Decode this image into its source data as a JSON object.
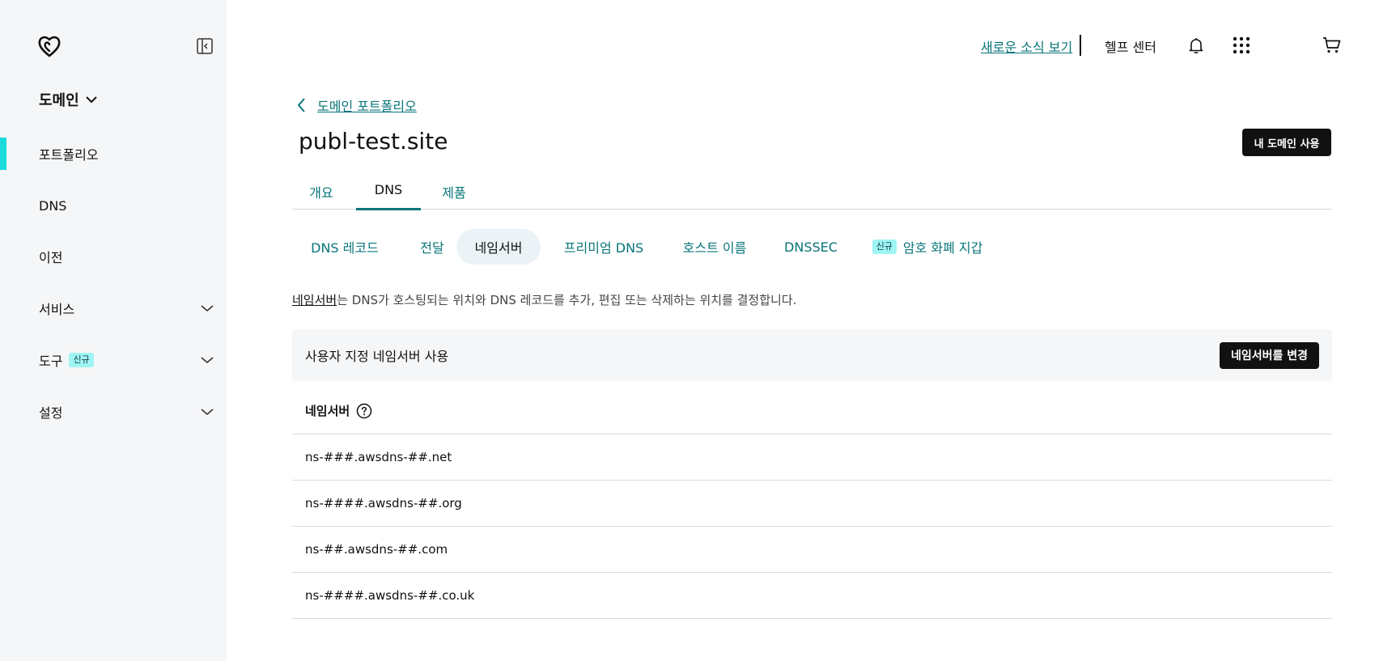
{
  "sidebar": {
    "section_title": "도메인",
    "items": [
      {
        "label": "포트폴리오",
        "active": true
      },
      {
        "label": "DNS"
      },
      {
        "label": "이전"
      },
      {
        "label": "서비스",
        "expandable": true
      },
      {
        "label": "도구",
        "badge": "신규",
        "expandable": true
      },
      {
        "label": "설정",
        "expandable": true
      }
    ]
  },
  "header": {
    "news_link": "새로운 소식 보기",
    "help": "헬프 센터",
    "icons": [
      "bell-icon",
      "apps-grid-icon",
      "cart-icon"
    ]
  },
  "main": {
    "breadcrumb": "도메인 포트폴리오",
    "domain": "publ-test.site",
    "use_domain_button": "내 도메인 사용",
    "tabs": [
      {
        "label": "개요"
      },
      {
        "label": "DNS",
        "active": true
      },
      {
        "label": "제품"
      }
    ],
    "subtabs": [
      {
        "label": "DNS 레코드"
      },
      {
        "label": "전달"
      },
      {
        "label": "네임서버",
        "active": true
      },
      {
        "label": "프리미엄 DNS"
      },
      {
        "label": "호스트 이름"
      },
      {
        "label": "DNSSEC"
      },
      {
        "label": "암호 화폐 지갑",
        "badge": "신규"
      }
    ],
    "description_link": "네임서버",
    "description_rest": "는 DNS가 호스팅되는 위치와 DNS 레코드를 추가, 편집 또는 삭제하는 위치를 결정합니다.",
    "custom_label": "사용자 지정 네임서버 사용",
    "change_button": "네임서버를 변경",
    "ns_header": "네임서버",
    "nameservers": [
      "ns-###.awsdns-##.net",
      "ns-####.awsdns-##.org",
      "ns-##.awsdns-##.com",
      "ns-####.awsdns-##.co.uk"
    ]
  },
  "colors": {
    "accent_teal": "#09757a",
    "active_indicator": "#1bdbdb",
    "badge_bg": "#9ff4f4",
    "sidebar_bg": "#f5f6f7",
    "button_dark": "#111111"
  }
}
